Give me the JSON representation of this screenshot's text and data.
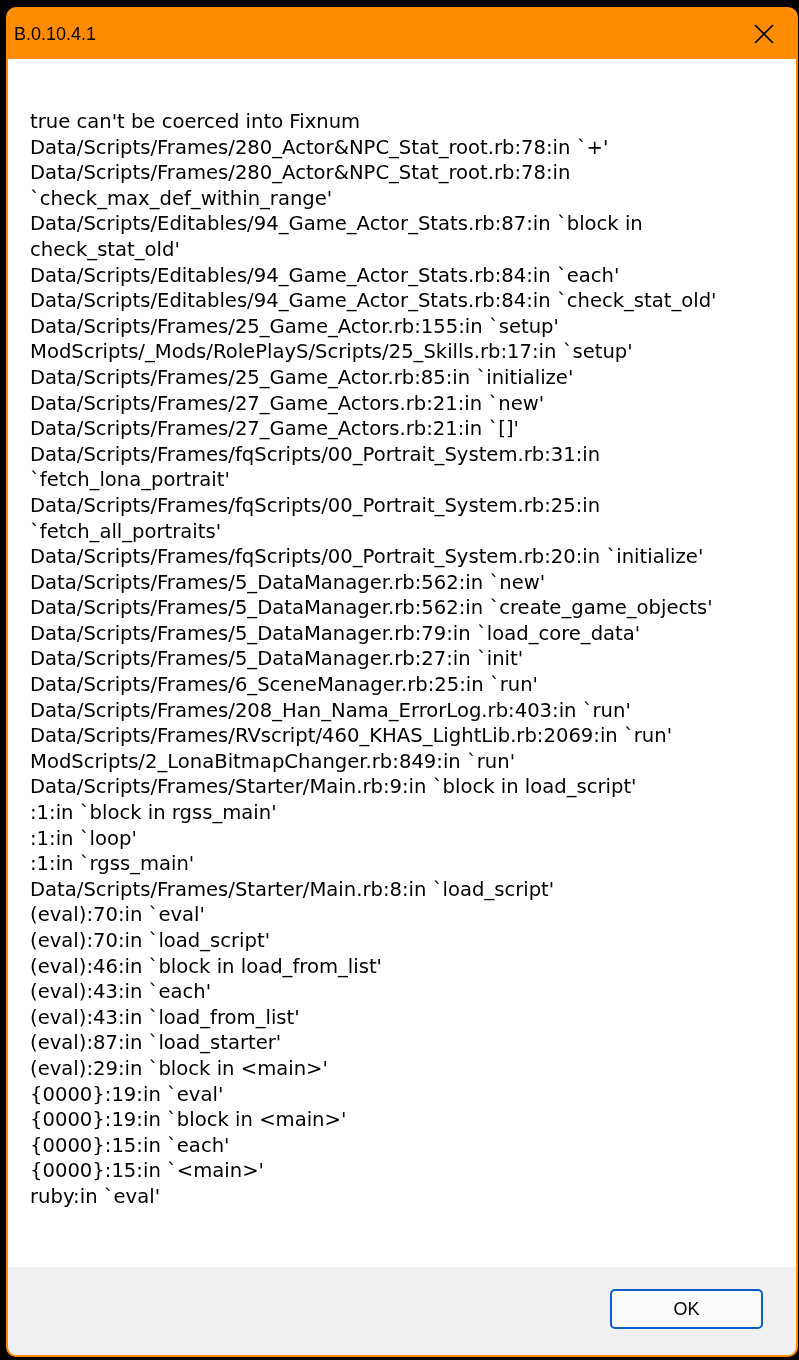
{
  "window": {
    "title": "B.0.10.4.1"
  },
  "message": "true can't be coerced into Fixnum",
  "trace": [
    "Data/Scripts/Frames/280_Actor&NPC_Stat_root.rb:78:in `+'",
    "Data/Scripts/Frames/280_Actor&NPC_Stat_root.rb:78:in `check_max_def_within_range'",
    "Data/Scripts/Editables/94_Game_Actor_Stats.rb:87:in `block in check_stat_old'",
    "Data/Scripts/Editables/94_Game_Actor_Stats.rb:84:in `each'",
    "Data/Scripts/Editables/94_Game_Actor_Stats.rb:84:in `check_stat_old'",
    "Data/Scripts/Frames/25_Game_Actor.rb:155:in `setup'",
    "ModScripts/_Mods/RolePlayS/Scripts/25_Skills.rb:17:in `setup'",
    "Data/Scripts/Frames/25_Game_Actor.rb:85:in `initialize'",
    "Data/Scripts/Frames/27_Game_Actors.rb:21:in `new'",
    "Data/Scripts/Frames/27_Game_Actors.rb:21:in `[]'",
    "Data/Scripts/Frames/fqScripts/00_Portrait_System.rb:31:in `fetch_lona_portrait'",
    "Data/Scripts/Frames/fqScripts/00_Portrait_System.rb:25:in `fetch_all_portraits'",
    "Data/Scripts/Frames/fqScripts/00_Portrait_System.rb:20:in `initialize'",
    "Data/Scripts/Frames/5_DataManager.rb:562:in `new'",
    "Data/Scripts/Frames/5_DataManager.rb:562:in `create_game_objects'",
    "Data/Scripts/Frames/5_DataManager.rb:79:in `load_core_data'",
    "Data/Scripts/Frames/5_DataManager.rb:27:in `init'",
    "Data/Scripts/Frames/6_SceneManager.rb:25:in `run'",
    "Data/Scripts/Frames/208_Han_Nama_ErrorLog.rb:403:in `run'",
    "Data/Scripts/Frames/RVscript/460_KHAS_LightLib.rb:2069:in `run'",
    "ModScripts/2_LonaBitmapChanger.rb:849:in `run'",
    "Data/Scripts/Frames/Starter/Main.rb:9:in `block in load_script'",
    ":1:in `block in rgss_main'",
    ":1:in `loop'",
    ":1:in `rgss_main'",
    "Data/Scripts/Frames/Starter/Main.rb:8:in `load_script'",
    "(eval):70:in `eval'",
    "(eval):70:in `load_script'",
    "(eval):46:in `block in load_from_list'",
    "(eval):43:in `each'",
    "(eval):43:in `load_from_list'",
    "(eval):87:in `load_starter'",
    "(eval):29:in `block in <main>'",
    "{0000}:19:in `eval'",
    "{0000}:19:in `block in <main>'",
    "{0000}:15:in `each'",
    "{0000}:15:in `<main>'",
    "ruby:in `eval'"
  ],
  "buttons": [
    "OK"
  ]
}
